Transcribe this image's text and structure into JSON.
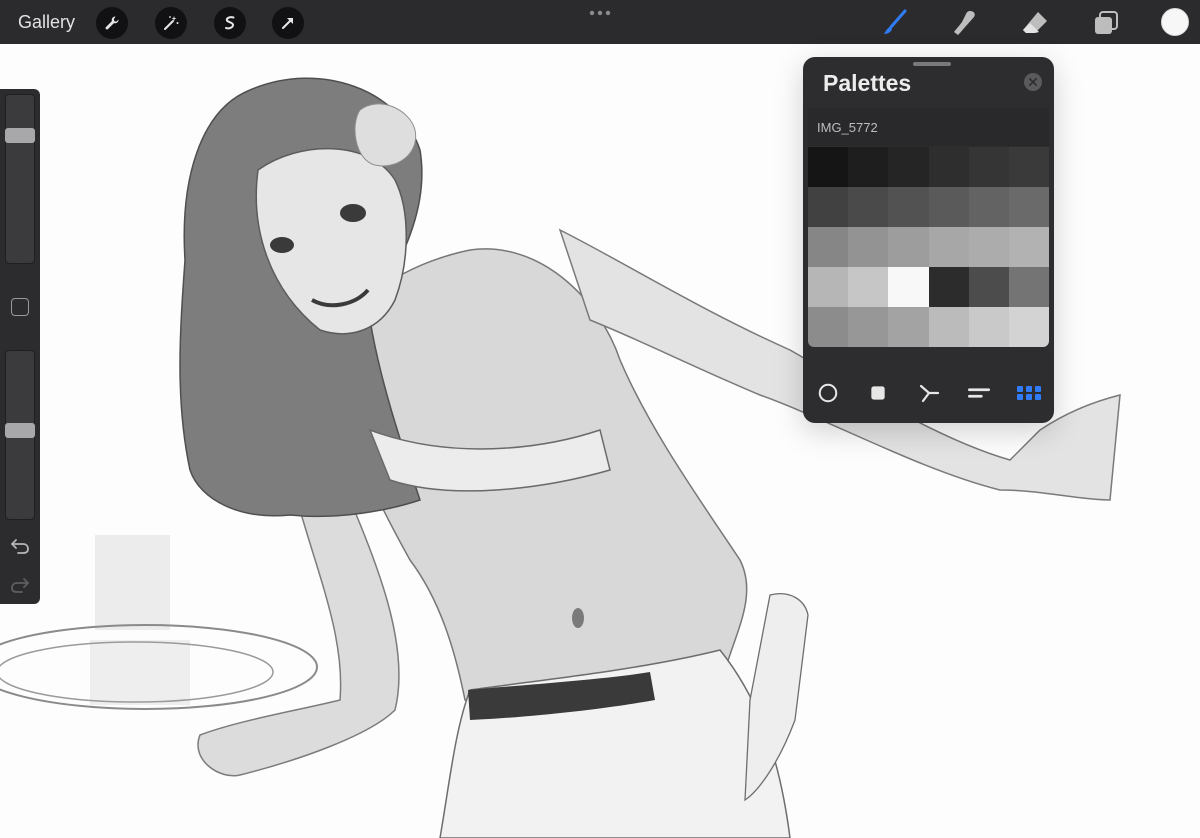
{
  "topbar": {
    "gallery_label": "Gallery",
    "left_tools": [
      "wrench-icon",
      "magic-wand-icon",
      "selection-icon",
      "transform-arrow-icon"
    ],
    "right_tools": [
      "brush-icon",
      "smudge-icon",
      "eraser-icon",
      "layers-icon"
    ],
    "active_tool": "brush-icon",
    "active_color": "#f7f7f7",
    "accent": "#2f7cf6"
  },
  "sidebar": {
    "size_slider_level": 0.78,
    "opacity_slider_level": 0.53
  },
  "palette": {
    "title": "Palettes",
    "name": "IMG_5772",
    "swatches": [
      "#151515",
      "#1e1e1e",
      "#252525",
      "#2e2e2e",
      "#353535",
      "#3a3a3a",
      "#414141",
      "#4a4a4a",
      "#525252",
      "#5a5a5a",
      "#636363",
      "#6a6a6a",
      "#868686",
      "#939393",
      "#9d9d9d",
      "#a7a7a7",
      "#acacac",
      "#b2b2b2",
      "#b6b6b6",
      "#c6c6c6",
      "#f8f8f8",
      "#2c2c2c",
      "#4c4c4c",
      "#747474",
      "#8c8c8c",
      "#979797",
      "#a3a3a3",
      "#bbbbbb",
      "#c9c9c9",
      "#d3d3d3"
    ],
    "tabs": [
      "disc-icon",
      "classic-icon",
      "harmony-icon",
      "value-icon",
      "palettes-icon"
    ],
    "active_tab": "palettes-icon"
  }
}
